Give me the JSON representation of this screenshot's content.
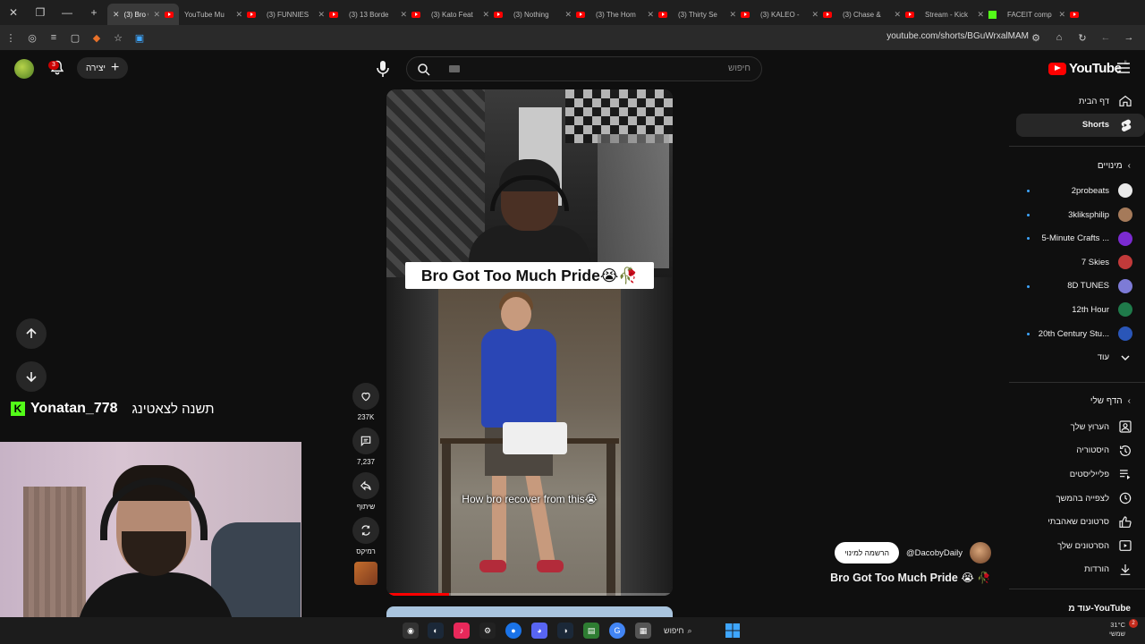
{
  "browser": {
    "tabs": [
      {
        "title": "(3) Bro G",
        "active": true
      },
      {
        "title": "YouTube Mu"
      },
      {
        "title": "(3) FUNNIES"
      },
      {
        "title": "(3) 13 Borde"
      },
      {
        "title": "(3) Kato Feat"
      },
      {
        "title": "(3) Nothing"
      },
      {
        "title": "(3) The Hom"
      },
      {
        "title": "(3) Thirty Se"
      },
      {
        "title": "(3) KALEO -"
      },
      {
        "title": "(3) Chase &"
      },
      {
        "title": "Stream - Kick"
      },
      {
        "title": "FACEIT comp"
      }
    ],
    "url": "youtube.com/shorts/BGuWrxalMAM"
  },
  "topbar": {
    "search_placeholder": "חיפוש",
    "create_label": "יצירה",
    "notification_count": "3",
    "logo_word": "YouTube",
    "logo_region": "IL"
  },
  "sidebar": {
    "nav": [
      {
        "label": "דף הבית",
        "icon": "home-icon"
      },
      {
        "label": "Shorts",
        "icon": "shorts-icon",
        "active": true
      }
    ],
    "subscriptions_header": "מינויים",
    "subscriptions": [
      {
        "name": "2probeats",
        "color": "#e9e9e9",
        "new": true
      },
      {
        "name": "3kliksphilip",
        "color": "#a57a5a",
        "new": true
      },
      {
        "name": "5-Minute Crafts ...",
        "color": "#7b2bd1",
        "new": true
      },
      {
        "name": "7 Skies",
        "color": "#c23a3a",
        "new": false
      },
      {
        "name": "8D TUNES",
        "color": "#7d7bd6",
        "new": true
      },
      {
        "name": "12th Hour",
        "color": "#1f7a4a",
        "new": false
      },
      {
        "name": "20th Century Stu...",
        "color": "#2a56b8",
        "new": true
      }
    ],
    "more_label": "עוד",
    "you_header": "הדף שלי",
    "you_items": [
      {
        "label": "הערוץ שלך",
        "icon": "channel-icon"
      },
      {
        "label": "היסטוריה",
        "icon": "history-icon"
      },
      {
        "label": "פלייליסטים",
        "icon": "playlists-icon"
      },
      {
        "label": "לצפייה בהמשך",
        "icon": "watch-later-icon"
      },
      {
        "label": "סרטונים שאהבתי",
        "icon": "liked-icon"
      },
      {
        "label": "הסרטונים שלך",
        "icon": "your-videos-icon"
      },
      {
        "label": "הורדות",
        "icon": "downloads-icon"
      }
    ],
    "more_from_youtube": "עוד מ-YouTube"
  },
  "short": {
    "banner_text": "Bro Got Too Much Pride😭🥀",
    "caption": "How bro recover from this😭",
    "progress": 0.22,
    "title": "Bro Got Too Much Pride 😭 🥀",
    "channel": "@DacobyDaily",
    "subscribe_label": "הרשמה למינוי"
  },
  "actions": {
    "likes": "237K",
    "comments": "7,237",
    "share": "שיתוף",
    "remix": "רמיקס"
  },
  "stream": {
    "username": "Yonatan_778",
    "note": "תשנה לצאטינג"
  },
  "taskbar": {
    "search": "חיפוש",
    "temp": "31°C",
    "weather": "שמשי",
    "badge": "2"
  }
}
